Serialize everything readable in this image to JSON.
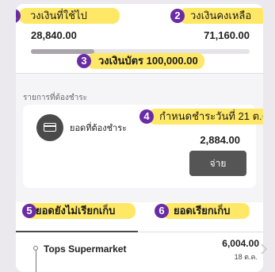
{
  "credit": {
    "used_label": "วงเงินที่ใช้ไป",
    "used_amount": "28,840.00",
    "remaining_label": "วงเงินคงเหลือ",
    "remaining_amount": "71,160.00",
    "limit_label": "วงเงินบัตร 100,000.00",
    "used_fraction": 0.2884
  },
  "payment": {
    "section_label": "รายการที่ต้องชำระ",
    "due_label": "ยอดที่ต้องชำระ",
    "due_date_label": "กำหนดชำระวันที่ 21 ต.ค.",
    "due_amount": "2,884.00",
    "pay_button": "จ่าย",
    "icon": "credit-card-icon"
  },
  "tabs": {
    "unbilled": "ยอดยังไม่เรียกเก็บ",
    "billed": "ยอดเรียกเก็บ",
    "active": "unbilled"
  },
  "transactions": [
    {
      "merchant": "Tops Supermarket",
      "amount": "6,004.00",
      "date": "18 ต.ค."
    }
  ],
  "annotations": [
    "1",
    "2",
    "3",
    "4",
    "5",
    "6"
  ],
  "colors": {
    "highlight": "#ffe866",
    "badge": "#6a2ca5",
    "button": "#555555"
  }
}
